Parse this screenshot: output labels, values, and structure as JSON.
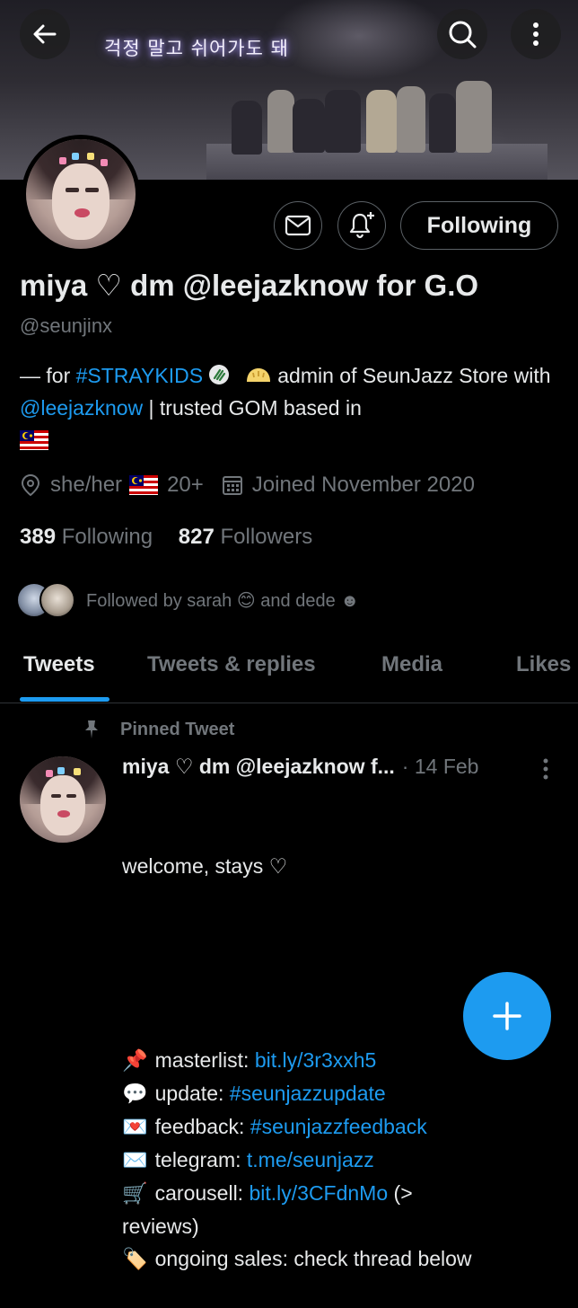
{
  "banner": {
    "text": "걱정 말고 쉬어가도 돼"
  },
  "toolbar": {
    "back_icon": "arrow-left-icon",
    "search_icon": "search-icon",
    "more_icon": "more-vertical-icon"
  },
  "profile": {
    "name": "miya ♡ dm @leejazknow for G.O",
    "handle": "@seunjinx",
    "following_button": "Following",
    "bio": {
      "prefix": "— for ",
      "hashtag": "#STRAYKIDS",
      "mid": " admin of SeunJazz Store with ",
      "mention": "@leejazknow",
      "suffix": " | trusted GOM based in "
    },
    "meta": {
      "pronouns": "she/her",
      "age": "20+",
      "joined": "Joined November 2020"
    },
    "following_count": "389",
    "following_label": "Following",
    "followers_count": "827",
    "followers_label": "Followers",
    "followed_by": "Followed by sarah 😊 and dede ☻"
  },
  "tabs": [
    "Tweets",
    "Tweets & replies",
    "Media",
    "Likes"
  ],
  "pinned_tweet": {
    "label": "Pinned Tweet",
    "author": "miya ♡ dm @leejazknow f...",
    "date": "· 14 Feb",
    "first_line": "welcome, stays ♡",
    "lines": [
      {
        "emoji": "📌",
        "label": "masterlist: ",
        "link": "bit.ly/3r3xxh5",
        "after": ""
      },
      {
        "emoji": "💬",
        "label": "update: ",
        "link": "#seunjazzupdate",
        "after": ""
      },
      {
        "emoji": "💌",
        "label": "feedback: ",
        "link": "#seunjazzfeedback",
        "after": ""
      },
      {
        "emoji": "✉️",
        "label": "telegram: ",
        "link": "t.me/seunjazz",
        "after": ""
      },
      {
        "emoji": "🛒",
        "label": "carousell: ",
        "link": "bit.ly/3CFdnMo",
        "after": " (>"
      },
      {
        "emoji": "",
        "label": "reviews)",
        "link": "",
        "after": ""
      },
      {
        "emoji": "🏷️",
        "label": "ongoing sales: check thread below",
        "link": "",
        "after": ""
      }
    ]
  },
  "colors": {
    "accent": "#1d9bf0",
    "muted": "#71767b",
    "text": "#e7e9ea",
    "background": "#000000"
  }
}
